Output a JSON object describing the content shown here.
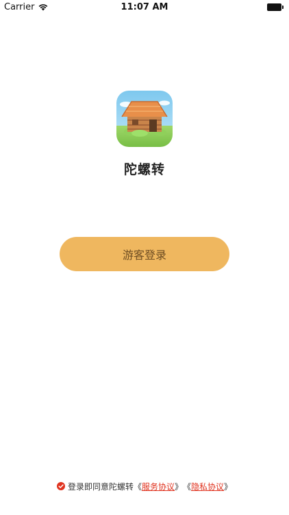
{
  "status_bar": {
    "carrier": "Carrier",
    "time": "11:07 AM",
    "wifi_icon": "wifi-icon",
    "battery_icon": "battery-icon"
  },
  "app": {
    "logo_icon": "hut-logo-icon",
    "name": "陀螺转"
  },
  "login": {
    "guest_label": "游客登录",
    "button_color": "#efb75f",
    "label_color": "#6d4c22"
  },
  "agreement": {
    "check_icon": "check-circle-icon",
    "prefix": "登录即同意陀螺转",
    "open_bracket": "《",
    "close_bracket": "》",
    "service_label": "服务协议",
    "privacy_label": "隐私协议",
    "link_color": "#e0331f"
  }
}
